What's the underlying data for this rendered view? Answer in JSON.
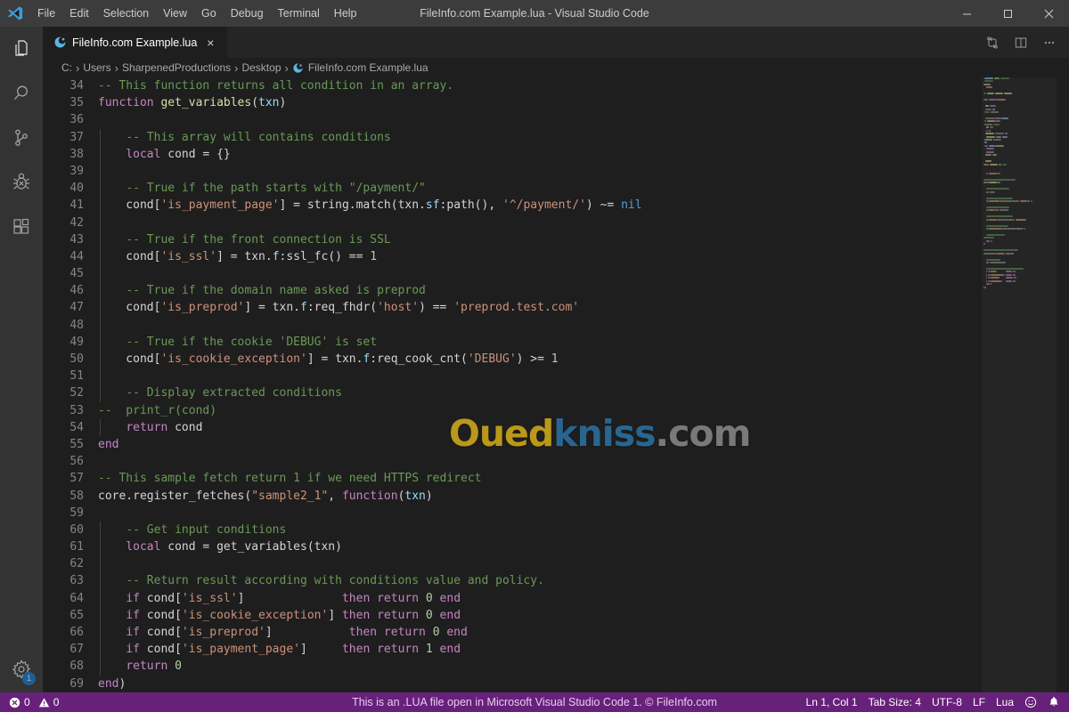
{
  "window": {
    "title": "FileInfo.com Example.lua - Visual Studio Code",
    "minimize_label": "Minimize",
    "maximize_label": "Maximize",
    "close_label": "Close"
  },
  "menubar": {
    "logo_icon": "vscode-logo-icon",
    "items": [
      {
        "label": "File"
      },
      {
        "label": "Edit"
      },
      {
        "label": "Selection"
      },
      {
        "label": "View"
      },
      {
        "label": "Go"
      },
      {
        "label": "Debug"
      },
      {
        "label": "Terminal"
      },
      {
        "label": "Help"
      }
    ]
  },
  "activitybar": {
    "items": [
      {
        "name": "explorer",
        "icon": "files-icon"
      },
      {
        "name": "search",
        "icon": "search-icon"
      },
      {
        "name": "source-control",
        "icon": "source-control-icon"
      },
      {
        "name": "run-and-debug",
        "icon": "debug-icon"
      },
      {
        "name": "extensions",
        "icon": "extensions-icon"
      }
    ],
    "manage": {
      "name": "manage",
      "icon": "gear-icon",
      "badge": "1"
    }
  },
  "tabs": {
    "active": {
      "label": "FileInfo.com Example.lua",
      "icon": "lua-file-icon",
      "close_label": "×"
    },
    "actions": [
      {
        "name": "split-editor-vertical",
        "icon": "split-editor-icon"
      },
      {
        "name": "open-changes",
        "icon": "compare-changes-icon"
      },
      {
        "name": "more-actions",
        "icon": "ellipsis-icon"
      }
    ]
  },
  "breadcrumbs": {
    "separator": "›",
    "items": [
      {
        "label": "C:",
        "icon": null
      },
      {
        "label": "Users",
        "icon": null
      },
      {
        "label": "SharpenedProductions",
        "icon": null
      },
      {
        "label": "Desktop",
        "icon": null
      },
      {
        "label": "FileInfo.com Example.lua",
        "icon": "lua-file-icon"
      }
    ]
  },
  "editor": {
    "first_line_number": 34,
    "language": "lua",
    "lines": [
      {
        "n": 34,
        "indent": 0,
        "tokens": [
          {
            "t": "-- This function returns all condition in an array.",
            "c": "c-comment"
          }
        ]
      },
      {
        "n": 35,
        "indent": 0,
        "tokens": [
          {
            "t": "function",
            "c": "c-keyword"
          },
          {
            "t": " ",
            "c": "c-plain"
          },
          {
            "t": "get_variables",
            "c": "c-func"
          },
          {
            "t": "(",
            "c": "c-plain"
          },
          {
            "t": "txn",
            "c": "c-var"
          },
          {
            "t": ")",
            "c": "c-plain"
          }
        ]
      },
      {
        "n": 36,
        "indent": 0,
        "tokens": []
      },
      {
        "n": 37,
        "indent": 1,
        "tokens": [
          {
            "t": "    ",
            "c": "c-plain"
          },
          {
            "t": "-- This array will contains conditions",
            "c": "c-comment"
          }
        ]
      },
      {
        "n": 38,
        "indent": 1,
        "tokens": [
          {
            "t": "    ",
            "c": "c-plain"
          },
          {
            "t": "local",
            "c": "c-keyword"
          },
          {
            "t": " cond = {}",
            "c": "c-plain"
          }
        ]
      },
      {
        "n": 39,
        "indent": 1,
        "tokens": []
      },
      {
        "n": 40,
        "indent": 1,
        "tokens": [
          {
            "t": "    ",
            "c": "c-plain"
          },
          {
            "t": "-- True if the path starts with \"/payment/\"",
            "c": "c-comment"
          }
        ]
      },
      {
        "n": 41,
        "indent": 1,
        "tokens": [
          {
            "t": "    cond[",
            "c": "c-plain"
          },
          {
            "t": "'is_payment_page'",
            "c": "c-string"
          },
          {
            "t": "] = string.match(txn.",
            "c": "c-plain"
          },
          {
            "t": "sf",
            "c": "c-var"
          },
          {
            "t": ":path(), ",
            "c": "c-plain"
          },
          {
            "t": "'^/payment/'",
            "c": "c-string"
          },
          {
            "t": ") ~= ",
            "c": "c-plain"
          },
          {
            "t": "nil",
            "c": "c-const"
          }
        ]
      },
      {
        "n": 42,
        "indent": 1,
        "tokens": []
      },
      {
        "n": 43,
        "indent": 1,
        "tokens": [
          {
            "t": "    ",
            "c": "c-plain"
          },
          {
            "t": "-- True if the front connection is SSL",
            "c": "c-comment"
          }
        ]
      },
      {
        "n": 44,
        "indent": 1,
        "tokens": [
          {
            "t": "    cond[",
            "c": "c-plain"
          },
          {
            "t": "'is_ssl'",
            "c": "c-string"
          },
          {
            "t": "] = txn.",
            "c": "c-plain"
          },
          {
            "t": "f",
            "c": "c-var"
          },
          {
            "t": ":ssl_fc() == ",
            "c": "c-plain"
          },
          {
            "t": "1",
            "c": "c-num"
          }
        ]
      },
      {
        "n": 45,
        "indent": 1,
        "tokens": []
      },
      {
        "n": 46,
        "indent": 1,
        "tokens": [
          {
            "t": "    ",
            "c": "c-plain"
          },
          {
            "t": "-- True if the domain name asked is preprod",
            "c": "c-comment"
          }
        ]
      },
      {
        "n": 47,
        "indent": 1,
        "tokens": [
          {
            "t": "    cond[",
            "c": "c-plain"
          },
          {
            "t": "'is_preprod'",
            "c": "c-string"
          },
          {
            "t": "] = txn.",
            "c": "c-plain"
          },
          {
            "t": "f",
            "c": "c-var"
          },
          {
            "t": ":req_fhdr(",
            "c": "c-plain"
          },
          {
            "t": "'host'",
            "c": "c-string"
          },
          {
            "t": ") == ",
            "c": "c-plain"
          },
          {
            "t": "'preprod.test.com'",
            "c": "c-string"
          }
        ]
      },
      {
        "n": 48,
        "indent": 1,
        "tokens": []
      },
      {
        "n": 49,
        "indent": 1,
        "tokens": [
          {
            "t": "    ",
            "c": "c-plain"
          },
          {
            "t": "-- True if the cookie 'DEBUG' is set",
            "c": "c-comment"
          }
        ]
      },
      {
        "n": 50,
        "indent": 1,
        "tokens": [
          {
            "t": "    cond[",
            "c": "c-plain"
          },
          {
            "t": "'is_cookie_exception'",
            "c": "c-string"
          },
          {
            "t": "] = txn.",
            "c": "c-plain"
          },
          {
            "t": "f",
            "c": "c-var"
          },
          {
            "t": ":req_cook_cnt(",
            "c": "c-plain"
          },
          {
            "t": "'DEBUG'",
            "c": "c-string"
          },
          {
            "t": ") >= ",
            "c": "c-plain"
          },
          {
            "t": "1",
            "c": "c-num"
          }
        ]
      },
      {
        "n": 51,
        "indent": 1,
        "tokens": []
      },
      {
        "n": 52,
        "indent": 1,
        "tokens": [
          {
            "t": "    ",
            "c": "c-plain"
          },
          {
            "t": "-- Display extracted conditions",
            "c": "c-comment"
          }
        ]
      },
      {
        "n": 53,
        "indent": 0,
        "tokens": [
          {
            "t": "--  print_r(cond)",
            "c": "c-comment"
          }
        ]
      },
      {
        "n": 54,
        "indent": 1,
        "tokens": [
          {
            "t": "    ",
            "c": "c-plain"
          },
          {
            "t": "return",
            "c": "c-keyword"
          },
          {
            "t": " cond",
            "c": "c-plain"
          }
        ]
      },
      {
        "n": 55,
        "indent": 0,
        "tokens": [
          {
            "t": "end",
            "c": "c-keyword"
          }
        ]
      },
      {
        "n": 56,
        "indent": 0,
        "tokens": []
      },
      {
        "n": 57,
        "indent": 0,
        "tokens": [
          {
            "t": "-- This sample fetch return 1 if we need HTTPS redirect",
            "c": "c-comment"
          }
        ]
      },
      {
        "n": 58,
        "indent": 0,
        "tokens": [
          {
            "t": "core.register_fetches(",
            "c": "c-plain"
          },
          {
            "t": "\"sample2_1\"",
            "c": "c-string"
          },
          {
            "t": ", ",
            "c": "c-plain"
          },
          {
            "t": "function",
            "c": "c-keyword"
          },
          {
            "t": "(",
            "c": "c-plain"
          },
          {
            "t": "txn",
            "c": "c-var"
          },
          {
            "t": ")",
            "c": "c-plain"
          }
        ]
      },
      {
        "n": 59,
        "indent": 0,
        "tokens": []
      },
      {
        "n": 60,
        "indent": 1,
        "tokens": [
          {
            "t": "    ",
            "c": "c-plain"
          },
          {
            "t": "-- Get input conditions",
            "c": "c-comment"
          }
        ]
      },
      {
        "n": 61,
        "indent": 1,
        "tokens": [
          {
            "t": "    ",
            "c": "c-plain"
          },
          {
            "t": "local",
            "c": "c-keyword"
          },
          {
            "t": " cond = get_variables(txn)",
            "c": "c-plain"
          }
        ]
      },
      {
        "n": 62,
        "indent": 1,
        "tokens": []
      },
      {
        "n": 63,
        "indent": 1,
        "tokens": [
          {
            "t": "    ",
            "c": "c-plain"
          },
          {
            "t": "-- Return result according with conditions value and policy.",
            "c": "c-comment"
          }
        ]
      },
      {
        "n": 64,
        "indent": 1,
        "tokens": [
          {
            "t": "    ",
            "c": "c-plain"
          },
          {
            "t": "if",
            "c": "c-keyword"
          },
          {
            "t": " cond[",
            "c": "c-plain"
          },
          {
            "t": "'is_ssl'",
            "c": "c-string"
          },
          {
            "t": "]              ",
            "c": "c-plain"
          },
          {
            "t": "then return",
            "c": "c-keyword"
          },
          {
            "t": " ",
            "c": "c-plain"
          },
          {
            "t": "0",
            "c": "c-num"
          },
          {
            "t": " ",
            "c": "c-plain"
          },
          {
            "t": "end",
            "c": "c-keyword"
          }
        ]
      },
      {
        "n": 65,
        "indent": 1,
        "tokens": [
          {
            "t": "    ",
            "c": "c-plain"
          },
          {
            "t": "if",
            "c": "c-keyword"
          },
          {
            "t": " cond[",
            "c": "c-plain"
          },
          {
            "t": "'is_cookie_exception'",
            "c": "c-string"
          },
          {
            "t": "] ",
            "c": "c-plain"
          },
          {
            "t": "then return",
            "c": "c-keyword"
          },
          {
            "t": " ",
            "c": "c-plain"
          },
          {
            "t": "0",
            "c": "c-num"
          },
          {
            "t": " ",
            "c": "c-plain"
          },
          {
            "t": "end",
            "c": "c-keyword"
          }
        ]
      },
      {
        "n": 66,
        "indent": 1,
        "tokens": [
          {
            "t": "    ",
            "c": "c-plain"
          },
          {
            "t": "if",
            "c": "c-keyword"
          },
          {
            "t": " cond[",
            "c": "c-plain"
          },
          {
            "t": "'is_preprod'",
            "c": "c-string"
          },
          {
            "t": "]           ",
            "c": "c-plain"
          },
          {
            "t": "then return",
            "c": "c-keyword"
          },
          {
            "t": " ",
            "c": "c-plain"
          },
          {
            "t": "0",
            "c": "c-num"
          },
          {
            "t": " ",
            "c": "c-plain"
          },
          {
            "t": "end",
            "c": "c-keyword"
          }
        ]
      },
      {
        "n": 67,
        "indent": 1,
        "tokens": [
          {
            "t": "    ",
            "c": "c-plain"
          },
          {
            "t": "if",
            "c": "c-keyword"
          },
          {
            "t": " cond[",
            "c": "c-plain"
          },
          {
            "t": "'is_payment_page'",
            "c": "c-string"
          },
          {
            "t": "]     ",
            "c": "c-plain"
          },
          {
            "t": "then return",
            "c": "c-keyword"
          },
          {
            "t": " ",
            "c": "c-plain"
          },
          {
            "t": "1",
            "c": "c-num"
          },
          {
            "t": " ",
            "c": "c-plain"
          },
          {
            "t": "end",
            "c": "c-keyword"
          }
        ]
      },
      {
        "n": 68,
        "indent": 1,
        "tokens": [
          {
            "t": "    ",
            "c": "c-plain"
          },
          {
            "t": "return",
            "c": "c-keyword"
          },
          {
            "t": " ",
            "c": "c-plain"
          },
          {
            "t": "0",
            "c": "c-num"
          }
        ]
      },
      {
        "n": 69,
        "indent": 0,
        "tokens": [
          {
            "t": "end",
            "c": "c-keyword"
          },
          {
            "t": ")",
            "c": "c-plain"
          }
        ]
      }
    ]
  },
  "watermark": {
    "part1": "Oued",
    "part2": "kniss",
    "part3": ".com"
  },
  "statusbar": {
    "errors_icon": "error-circle-icon",
    "errors_count": "0",
    "warnings_icon": "warning-triangle-icon",
    "warnings_count": "0",
    "center_message": "This is an .LUA file open in Microsoft Visual Studio Code 1. © FileInfo.com",
    "cursor_position": "Ln 1, Col 1",
    "tab_size": "Tab Size: 4",
    "encoding": "UTF-8",
    "eol": "LF",
    "language_mode": "Lua",
    "feedback_icon": "smiley-icon",
    "notifications_icon": "bell-icon"
  }
}
